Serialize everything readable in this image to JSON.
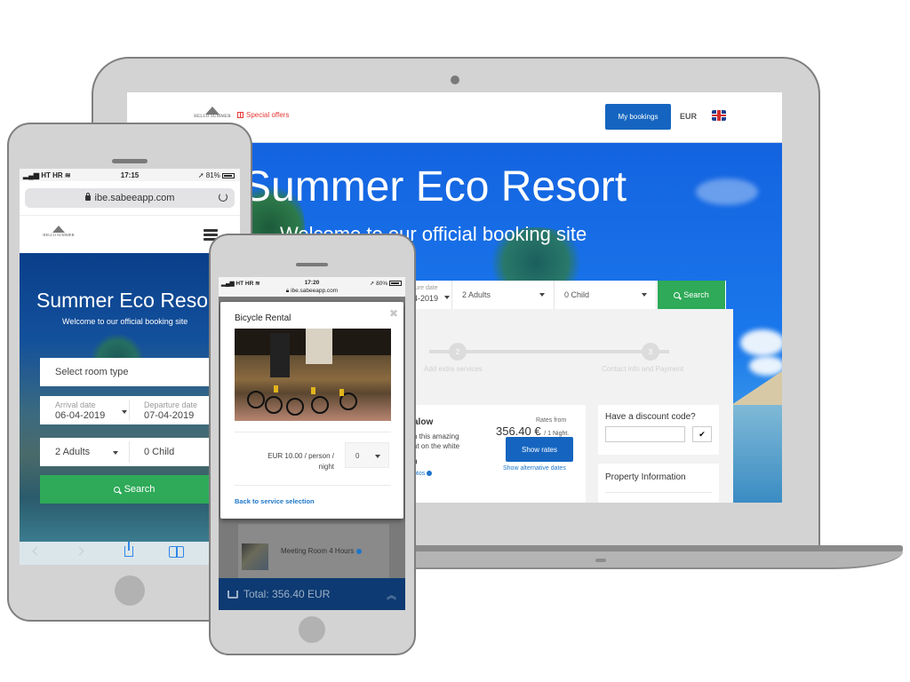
{
  "laptop": {
    "header": {
      "logo_text": "HELLO SUMMER",
      "logo_subtext": "ECO RESORT",
      "special_offers": "Special offers",
      "my_bookings": "My bookings",
      "currency": "EUR",
      "language_flag": "uk-flag-icon"
    },
    "hero": {
      "title": "Summer Eco Resort",
      "subtitle": "Welcome to our official booking site"
    },
    "booking_bar": {
      "departure_label": "ture date",
      "departure_value": "4-2019",
      "adults": "2 Adults",
      "children": "0 Child",
      "search": "Search"
    },
    "steps": [
      {
        "number": "2",
        "label": "Add extra services"
      },
      {
        "number": "3",
        "label": "Contact info and Payment"
      }
    ],
    "room": {
      "name": "alow",
      "desc_line1": "n this amazing",
      "desc_line2": "nt on the white",
      "size": "0",
      "photos_link": "otos",
      "rates_from": "Rates from",
      "price": "356.40 €",
      "per_night": "/ 1 Night.",
      "show_rates": "Show rates",
      "alt_dates": "Show alternative dates"
    },
    "discount": {
      "title": "Have a discount code?",
      "input_value": "",
      "apply_icon": "checkmark-icon"
    },
    "property_info": {
      "title": "Property Information"
    }
  },
  "phone_large": {
    "status": {
      "carrier": "HT HR",
      "time": "17:15",
      "battery": "81%"
    },
    "url": "ibe.sabeeapp.com",
    "logo_text": "HELLO SUMMER",
    "logo_subtext": "ECO RESORT",
    "hero": {
      "title": "Summer Eco Resort",
      "subtitle": "Welcome to our official booking site"
    },
    "form": {
      "room_type": "Select room type",
      "arrival_label": "Arrival date",
      "arrival_value": "06-04-2019",
      "departure_label": "Departure date",
      "departure_value": "07-04-2019",
      "adults": "2 Adults",
      "children": "0 Child",
      "search": "Search"
    }
  },
  "phone_small": {
    "status": {
      "carrier": "HT HR",
      "time": "17:20",
      "battery": "80%"
    },
    "url": "ibe.sabeeapp.com",
    "modal": {
      "title": "Bicycle Rental",
      "price_line1": "EUR 10.00 / person /",
      "price_line2": "night",
      "quantity": "0",
      "back_link": "Back to service selection"
    },
    "background_item": "Meeting Room 4 Hours",
    "cart_total": "Total: 356.40 EUR"
  },
  "colors": {
    "primary_blue": "#1565c0",
    "search_green": "#2eaa58",
    "cart_navy": "#0d3a72",
    "special_offers_red": "#e53935",
    "link_blue": "#1e76c8"
  }
}
